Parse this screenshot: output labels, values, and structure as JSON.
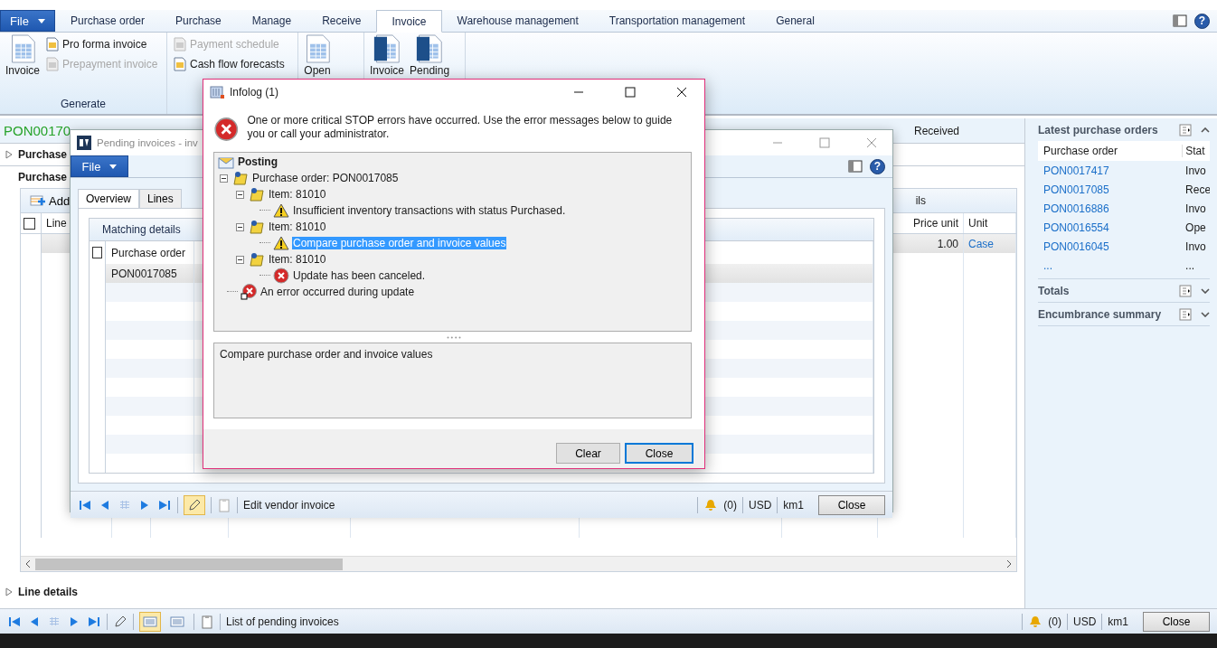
{
  "main": {
    "file_menu": "File",
    "ribbon_tabs": [
      {
        "label": "Purchase order",
        "selected": false
      },
      {
        "label": "Purchase",
        "selected": false
      },
      {
        "label": "Manage",
        "selected": false
      },
      {
        "label": "Receive",
        "selected": false
      },
      {
        "label": "Invoice",
        "selected": true
      },
      {
        "label": "Warehouse management",
        "selected": false
      },
      {
        "label": "Transportation management",
        "selected": false
      },
      {
        "label": "General",
        "selected": false
      }
    ],
    "help_label": "?",
    "ribbon_groups": [
      {
        "label": "Generate",
        "buttons": [
          {
            "label": "Invoice",
            "kind": "large",
            "disabled": false
          },
          {
            "label": "Pro forma invoice",
            "kind": "small",
            "disabled": false
          },
          {
            "label": "Prepayment invoice",
            "kind": "small",
            "disabled": true
          }
        ]
      },
      {
        "buttons": [
          {
            "label": "Payment schedule",
            "kind": "small",
            "disabled": true
          },
          {
            "label": "Cash flow forecasts",
            "kind": "small",
            "disabled": false
          }
        ]
      },
      {
        "buttons": [
          {
            "label": "Open",
            "kind": "large",
            "disabled": false
          }
        ]
      },
      {
        "buttons": [
          {
            "label": "Invoice",
            "kind": "large",
            "disabled": false
          },
          {
            "label": "Pending",
            "kind": "large",
            "disabled": false
          }
        ]
      }
    ],
    "header": {
      "title": "PON00170",
      "status": "Received"
    },
    "sections": [
      {
        "label": "Purchase",
        "expanded": false
      }
    ],
    "lines_heading": "Purchase",
    "lines_toolbar": {
      "add": "Add",
      "column_2": "ils"
    },
    "lines_grid": {
      "select_all_checked": false,
      "columns": [
        "Line",
        "Price unit",
        "Unit"
      ],
      "rows": [
        {
          "price_unit": "1.00",
          "unit": "Case"
        }
      ]
    },
    "line_details": {
      "label": "Line details",
      "expanded": false
    },
    "status_bar": {
      "views": [
        {
          "selected": true
        },
        {
          "selected": false
        }
      ],
      "text": "List of pending invoices",
      "alerts": "(0)",
      "currency": "USD",
      "company": "km1",
      "close": "Close"
    },
    "factboxes": [
      {
        "title": "Latest purchase orders",
        "expanded": true,
        "columns": [
          "Purchase order",
          "Stat"
        ],
        "rows": [
          {
            "purchase_order": "PON0017417",
            "status": "Invo"
          },
          {
            "purchase_order": "PON0017085",
            "status": "Rece"
          },
          {
            "purchase_order": "PON0016886",
            "status": "Invo"
          },
          {
            "purchase_order": "PON0016554",
            "status": "Ope"
          },
          {
            "purchase_order": "PON0016045",
            "status": "Invo"
          },
          {
            "purchase_order": "...",
            "status": "..."
          }
        ]
      },
      {
        "title": "Totals",
        "expanded": false
      },
      {
        "title": "Encumbrance summary",
        "expanded": false
      }
    ]
  },
  "pending_window": {
    "title": "Pending invoices - inv",
    "file_menu": "File",
    "help_label": "?",
    "tabs": [
      {
        "label": "Overview",
        "selected": true
      },
      {
        "label": "Lines",
        "selected": false
      }
    ],
    "group_tab": "Matching details",
    "grid": {
      "select_all_checked": false,
      "columns": [
        "Purchase order"
      ],
      "rows": [
        {
          "purchase_order": "PON0017085"
        }
      ]
    },
    "status_bar": {
      "edit_active": true,
      "text": "Edit vendor invoice",
      "alerts": "(0)",
      "currency": "USD",
      "company": "km1",
      "close": "Close"
    }
  },
  "infolog": {
    "title": "Infolog (1)",
    "message": "One or more critical STOP errors have occurred. Use the error messages below to guide you or call your administrator.",
    "tree": [
      {
        "label": "Posting",
        "kind": "posting",
        "selected": false,
        "children": [
          {
            "label": "Purchase order: PON0017085",
            "kind": "record",
            "selected": false,
            "expanded": true,
            "children": [
              {
                "label": "Item: 81010",
                "kind": "record",
                "selected": false,
                "expanded": true,
                "children": [
                  {
                    "label": "Insufficient inventory transactions with status Purchased.",
                    "kind": "warning",
                    "selected": false
                  }
                ]
              },
              {
                "label": "Item: 81010",
                "kind": "record",
                "selected": false,
                "expanded": true,
                "children": [
                  {
                    "label": "Compare purchase order and invoice values",
                    "kind": "warning",
                    "selected": true
                  }
                ]
              },
              {
                "label": "Item: 81010",
                "kind": "record",
                "selected": false,
                "expanded": true,
                "children": [
                  {
                    "label": "Update has been canceled.",
                    "kind": "error",
                    "selected": false
                  }
                ]
              }
            ]
          },
          {
            "label": "An error occurred during update",
            "kind": "stop",
            "selected": false
          }
        ]
      }
    ],
    "detail": "Compare purchase order and invoice values",
    "buttons": [
      {
        "label": "Clear",
        "default": false
      },
      {
        "label": "Close",
        "default": true
      }
    ]
  }
}
